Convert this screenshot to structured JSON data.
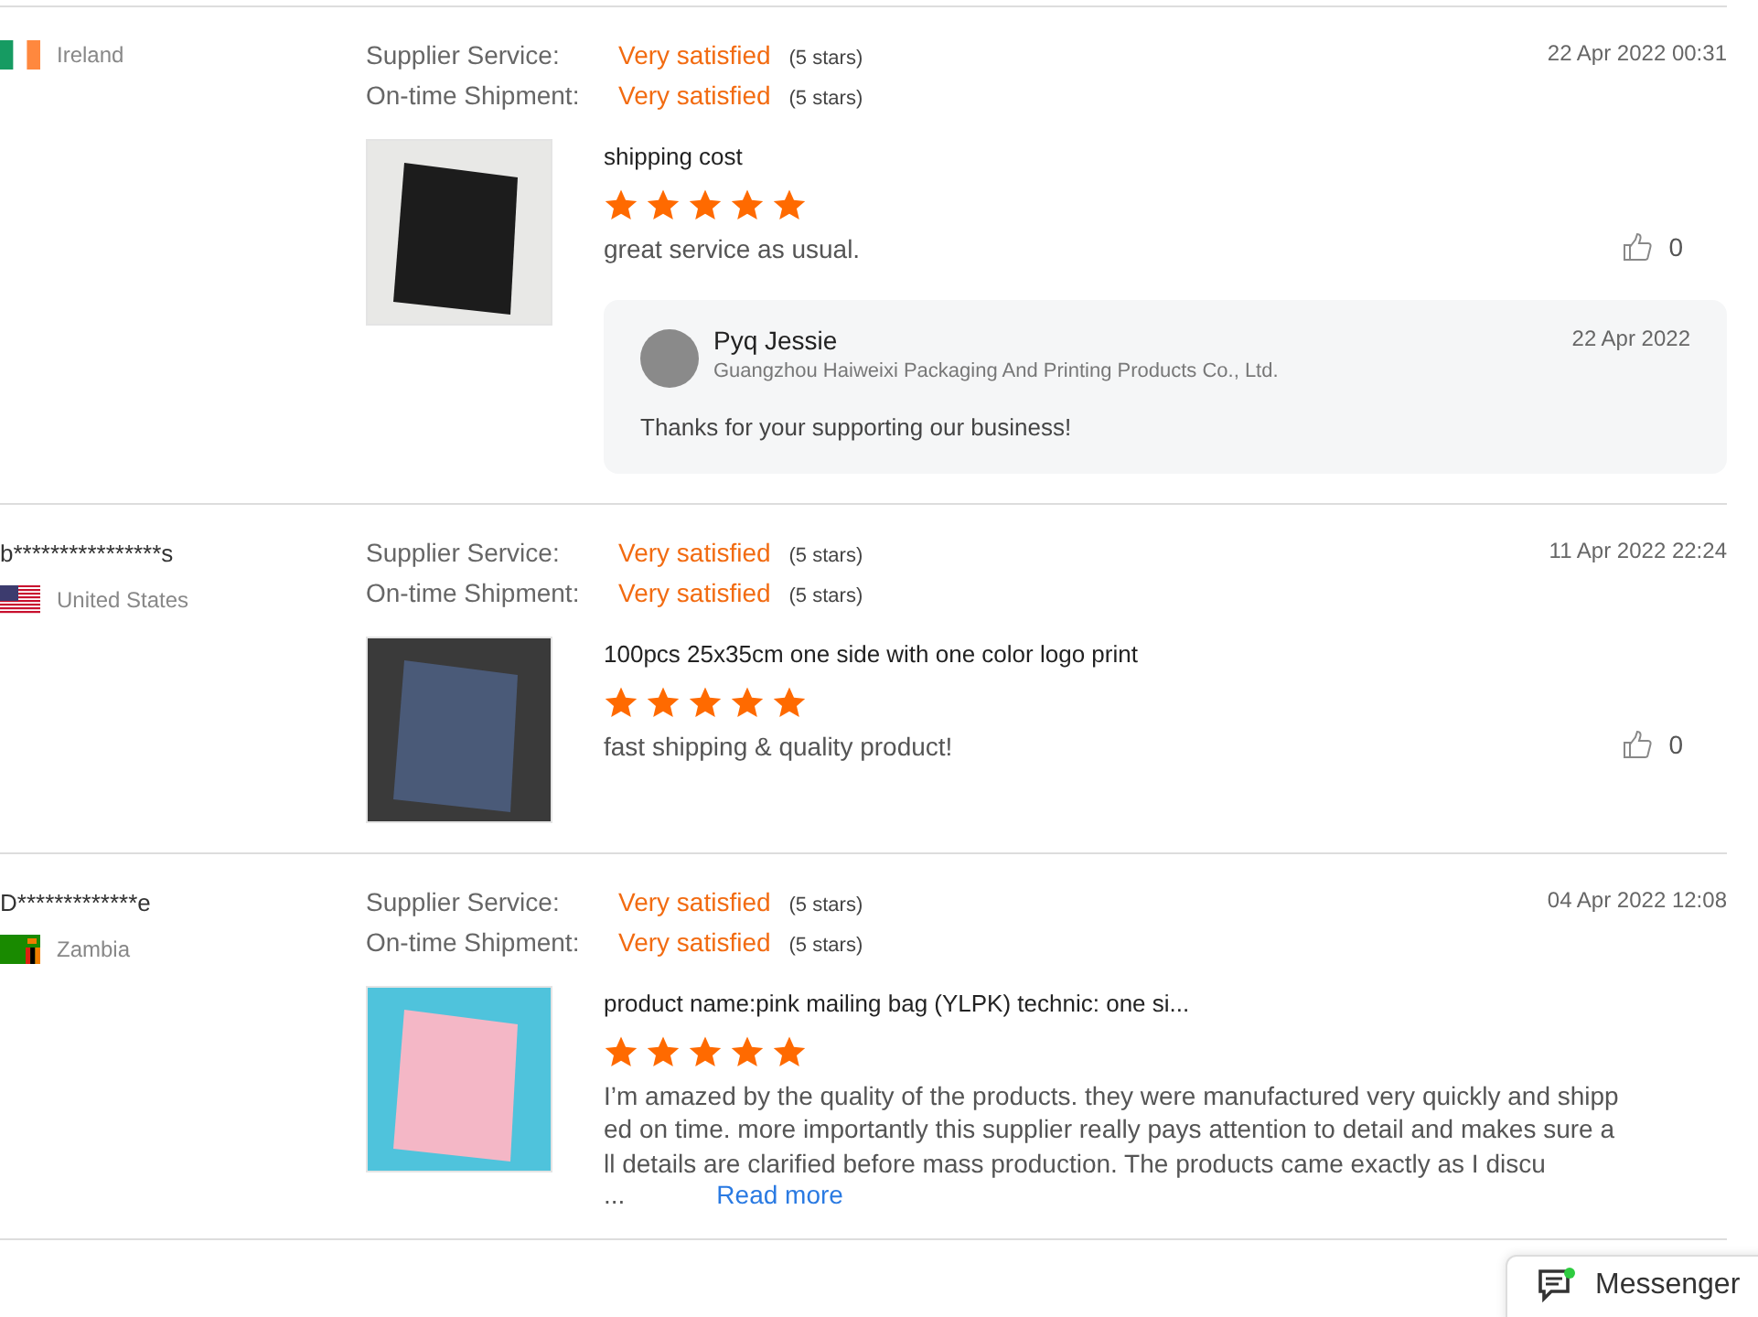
{
  "reviews": [
    {
      "flag": {
        "kind": "tricolor"
      },
      "country": "Ireland",
      "ratings": [
        {
          "label": "Supplier Service:",
          "verdict": "Very satisfied",
          "note": "(5 stars)"
        },
        {
          "label": "On-time Shipment:",
          "verdict": "Very satisfied",
          "note": "(5 stars)"
        }
      ],
      "date": "22 Apr 2022 00:31",
      "photo": {
        "kind": "dark"
      },
      "product": "shipping cost",
      "stars": 5,
      "text": "great service as usual.",
      "likes": "0",
      "reply": {
        "name": "Pyq Jessie",
        "company": "Guangzhou Haiweixi Packaging And Printing Products Co., Ltd.",
        "date": "22 Apr 2022",
        "text": "Thanks for your supporting our business!"
      }
    },
    {
      "buyer": "b****************s",
      "flag": {
        "kind": "stars-stripes"
      },
      "country": "United States",
      "ratings": [
        {
          "label": "Supplier Service:",
          "verdict": "Very satisfied",
          "note": "(5 stars)"
        },
        {
          "label": "On-time Shipment:",
          "verdict": "Very satisfied",
          "note": "(5 stars)"
        }
      ],
      "date": "11 Apr 2022 22:24",
      "photo": {
        "kind": "grey"
      },
      "product": "100pcs 25x35cm one side with one color logo print",
      "stars": 5,
      "text": "fast shipping & quality product!",
      "likes": "0"
    },
    {
      "buyer": "D*************e",
      "flag": {
        "kind": "green-field"
      },
      "country": "Zambia",
      "ratings": [
        {
          "label": "Supplier Service:",
          "verdict": "Very satisfied",
          "note": "(5 stars)"
        },
        {
          "label": "On-time Shipment:",
          "verdict": "Very satisfied",
          "note": "(5 stars)"
        }
      ],
      "date": "04 Apr 2022 12:08",
      "photo": {
        "kind": "pink"
      },
      "product": "product name:pink mailing bag (YLPK) technic: one si...",
      "stars": 5,
      "text": "I’m amazed by the quality of the products. they were manufactured very quickly and shipped on time. more importantly this supplier really pays attention to detail and makes sure all details are clarified before mass production. The products came exactly as I discu",
      "ellipsis": "...",
      "read_more": "Read more"
    }
  ],
  "messenger": {
    "label": "Messenger",
    "online": true
  }
}
